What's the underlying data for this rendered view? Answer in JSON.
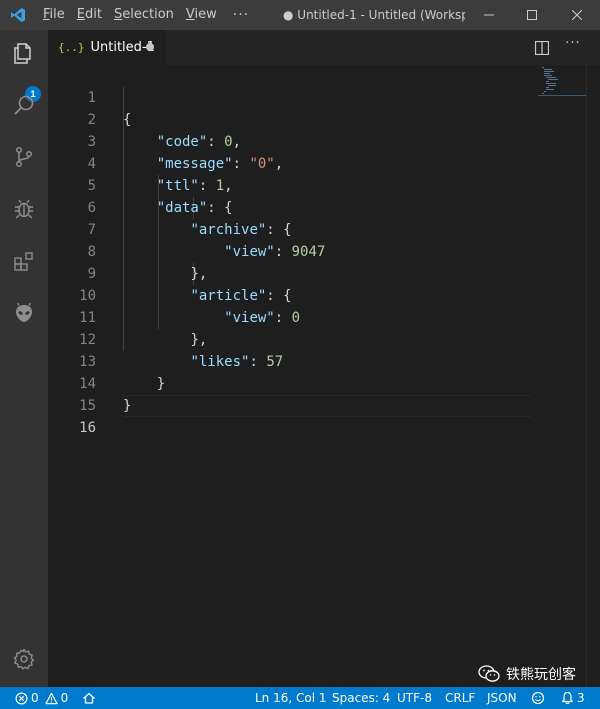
{
  "titlebar": {
    "menu": [
      {
        "label": "File",
        "mnemonic": "F"
      },
      {
        "label": "Edit",
        "mnemonic": "E"
      },
      {
        "label": "Selection",
        "mnemonic": "S"
      },
      {
        "label": "View",
        "mnemonic": "V"
      }
    ],
    "more": "···",
    "title": "● Untitled-1 - Untitled (Worksp..."
  },
  "activitybar": {
    "icons": [
      "explorer-icon",
      "search-icon",
      "source-control-icon",
      "debug-icon",
      "extensions-icon",
      "alien-icon",
      "settings-gear-icon"
    ],
    "explorer_badge": "1"
  },
  "tab": {
    "icon": "{..}",
    "label": "Untitled-1"
  },
  "editor": {
    "lines": [
      {
        "n": "1"
      },
      {
        "n": "2"
      },
      {
        "n": "3"
      },
      {
        "n": "4"
      },
      {
        "n": "5"
      },
      {
        "n": "6"
      },
      {
        "n": "7"
      },
      {
        "n": "8"
      },
      {
        "n": "9"
      },
      {
        "n": "10"
      },
      {
        "n": "11"
      },
      {
        "n": "12"
      },
      {
        "n": "13"
      },
      {
        "n": "14"
      },
      {
        "n": "15"
      },
      {
        "n": "16"
      }
    ],
    "tokens": {
      "open_brace": "{",
      "close_brace": "}",
      "code_key": "\"code\"",
      "code_val": "0",
      "message_key": "\"message\"",
      "message_val": "\"0\"",
      "ttl_key": "\"ttl\"",
      "ttl_val": "1",
      "data_key": "\"data\"",
      "archive_key": "\"archive\"",
      "view_key": "\"view\"",
      "archive_view_val": "9047",
      "article_key": "\"article\"",
      "article_view_val": "0",
      "likes_key": "\"likes\"",
      "likes_val": "57"
    }
  },
  "statusbar": {
    "errors": "0",
    "warnings": "0",
    "cursor": "Ln 16, Col 1",
    "spaces": "Spaces: 4",
    "encoding": "UTF-8",
    "eol": "CRLF",
    "language": "JSON",
    "notifications": "3"
  },
  "watermark": {
    "text": "铁熊玩创客"
  }
}
